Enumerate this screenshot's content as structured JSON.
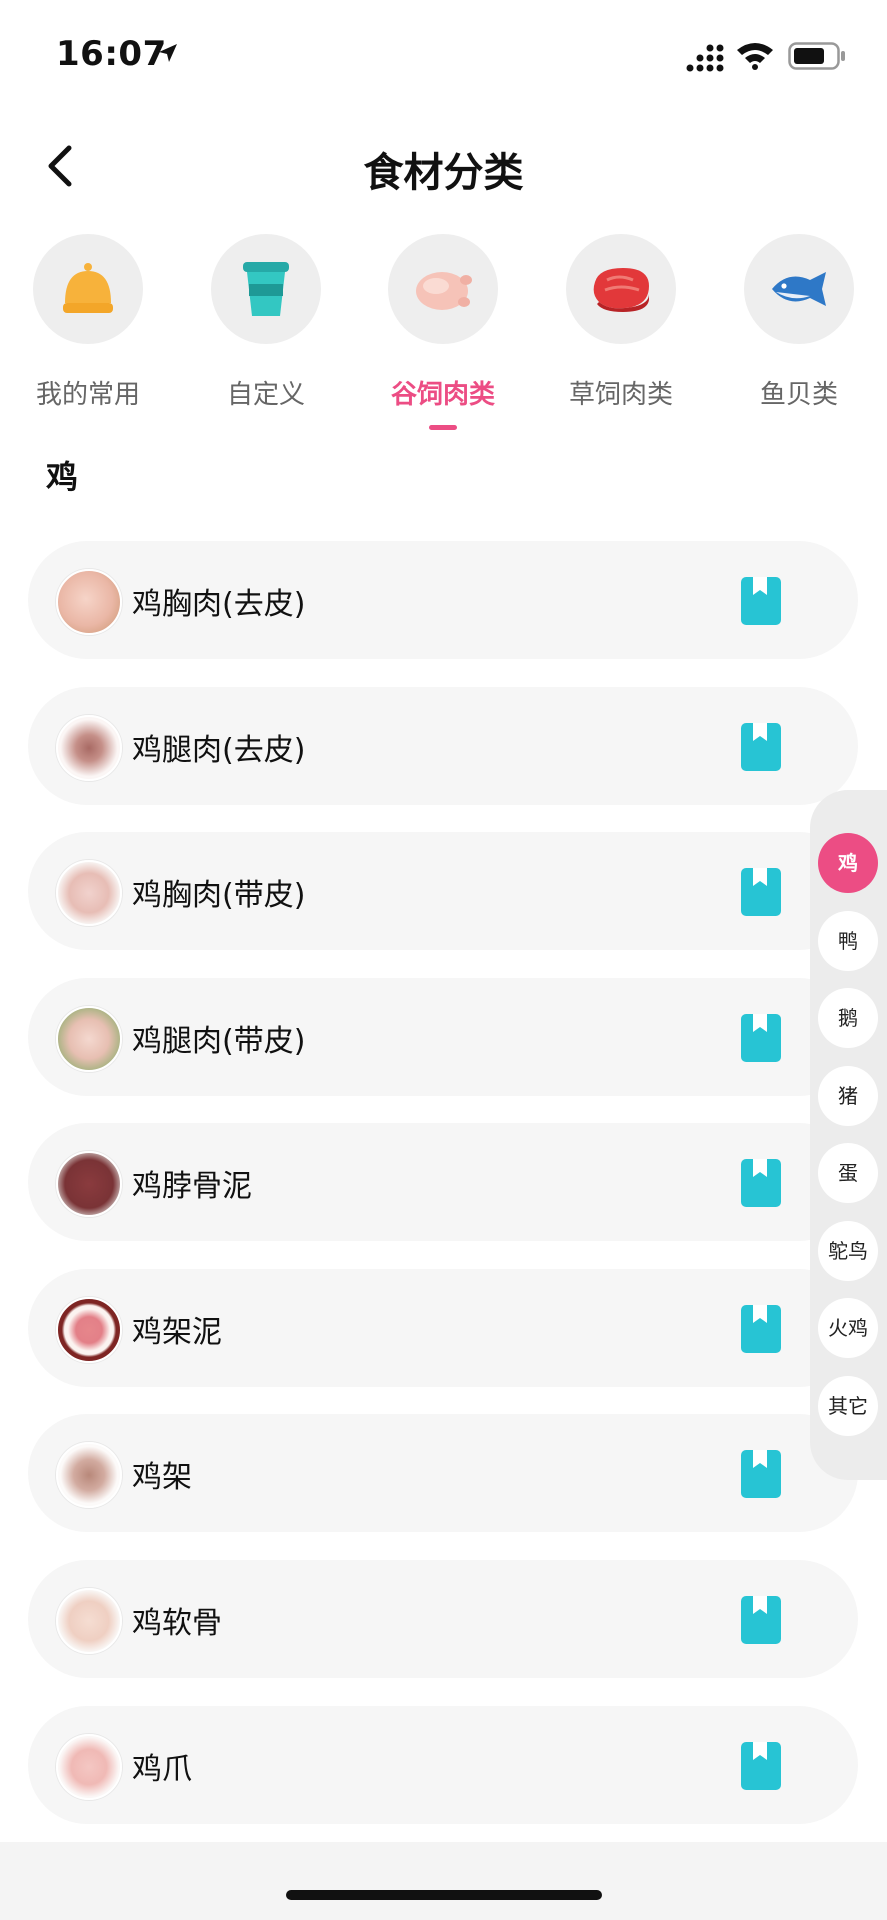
{
  "status_bar": {
    "time": "16:07"
  },
  "header": {
    "title": "食材分类"
  },
  "categories": [
    {
      "label": "我的常用",
      "icon": "bell-icon"
    },
    {
      "label": "自定义",
      "icon": "cup-icon"
    },
    {
      "label": "谷饲肉类",
      "icon": "chicken-icon",
      "active": true
    },
    {
      "label": "草饲肉类",
      "icon": "steak-icon"
    },
    {
      "label": "鱼贝类",
      "icon": "fish-icon"
    }
  ],
  "section": {
    "heading": "鸡"
  },
  "items": [
    {
      "name": "鸡胸肉(去皮)"
    },
    {
      "name": "鸡腿肉(去皮)"
    },
    {
      "name": "鸡胸肉(带皮)"
    },
    {
      "name": "鸡腿肉(带皮)"
    },
    {
      "name": "鸡脖骨泥"
    },
    {
      "name": "鸡架泥"
    },
    {
      "name": "鸡架"
    },
    {
      "name": "鸡软骨"
    },
    {
      "name": "鸡爪"
    }
  ],
  "index_bar": [
    "鸡",
    "鸭",
    "鹅",
    "猪",
    "蛋",
    "鸵鸟",
    "火鸡",
    "其它"
  ],
  "colors": {
    "accent": "#ec4d84",
    "doc_icon": "#27c4d4"
  }
}
